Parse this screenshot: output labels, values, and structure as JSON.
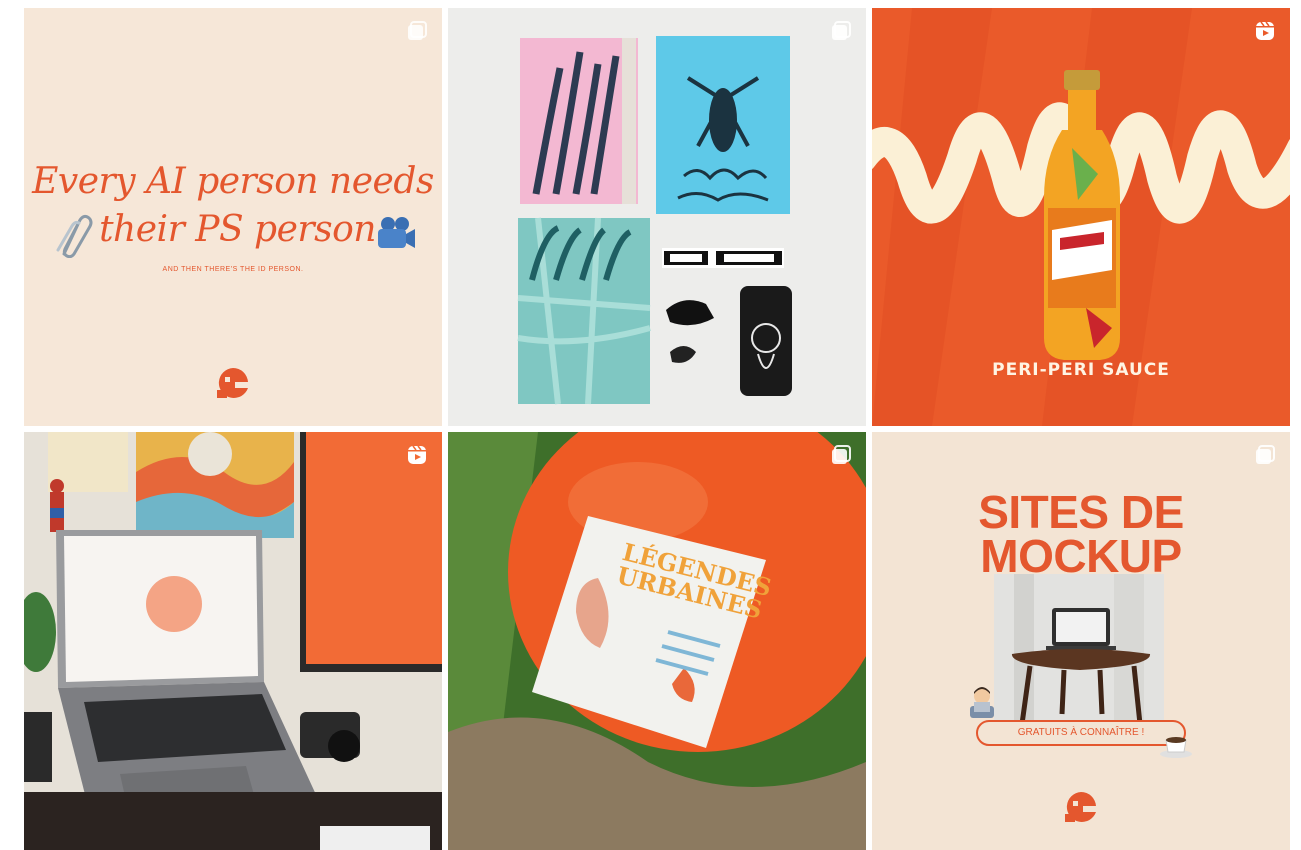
{
  "grid": {
    "posts": [
      {
        "type": "carousel",
        "headline_line1": "Every AI person needs",
        "headline_line2": "their PS person.",
        "subline": "AND THEN THERE'S THE ID PERSON."
      },
      {
        "type": "carousel"
      },
      {
        "type": "reel",
        "caption": "PERI-PERI SAUCE"
      },
      {
        "type": "reel"
      },
      {
        "type": "carousel",
        "poster_line1": "LÉGENDES",
        "poster_line2": "URBAINES"
      },
      {
        "type": "carousel",
        "title_line1": "SITES DE",
        "title_line2": "MOCKUP",
        "pill_text": "GRATUITS À CONNAÎTRE !"
      }
    ]
  },
  "colors": {
    "brand_orange": "#e4572e",
    "cream": "#f6e7d8"
  },
  "icons": {
    "carousel": "carousel-icon",
    "reel": "reel-icon"
  }
}
